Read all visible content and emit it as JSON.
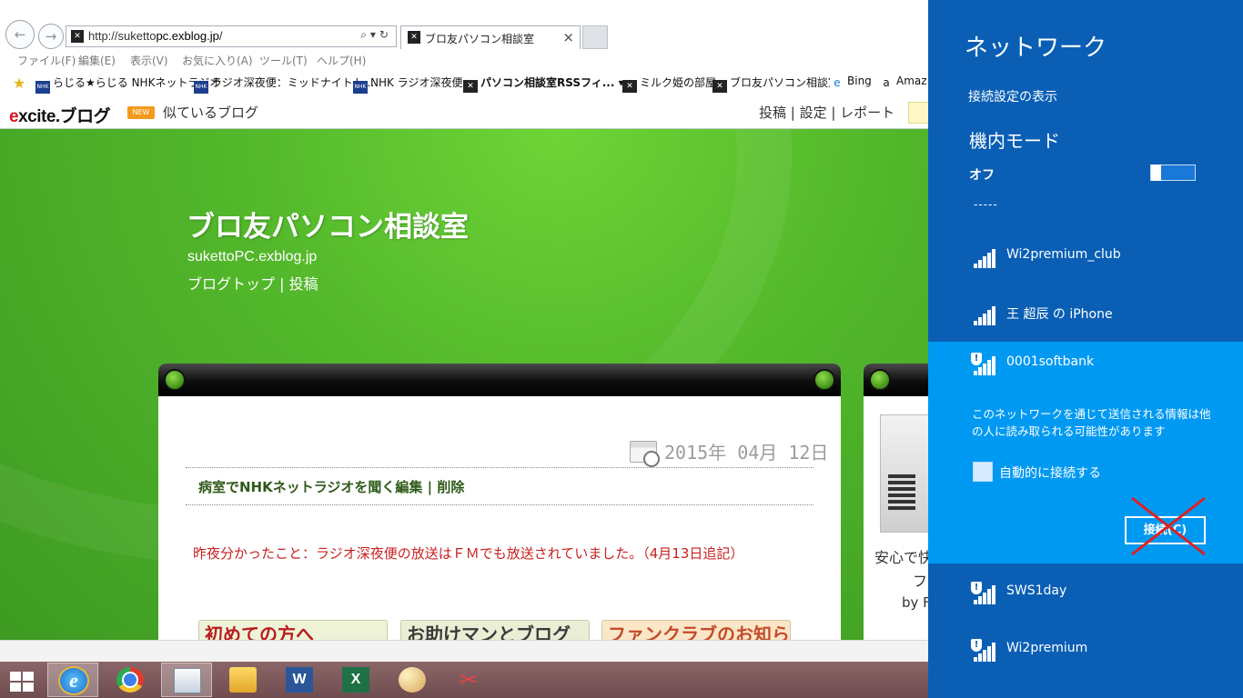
{
  "browser": {
    "url_prefix": "http://suketto",
    "url_domain": "pc.exblog.jp",
    "url_suffix": "/",
    "tab_title": "ブロ友パソコン相談室",
    "tab_close": "×",
    "menu": [
      "ファイル(F)",
      "編集(E)",
      "表示(V)",
      "お気に入り(A)",
      "ツール(T)",
      "ヘルプ(H)"
    ],
    "favorites": [
      {
        "icon": "NHK",
        "label": "らじる★らじる NHKネットラジオ"
      },
      {
        "icon": "NHK",
        "label": "ラジオ深夜便：ミッドナイトト..."
      },
      {
        "icon": "NHK",
        "label": "NHK ラジオ深夜便"
      },
      {
        "icon": "x",
        "label": "パソコン相談室RSSフィ... ▾"
      },
      {
        "icon": "x",
        "label": "ミルク姫の部屋"
      },
      {
        "icon": "x",
        "label": "ブロ友パソコン相談室"
      },
      {
        "icon": "e",
        "label": "Bing"
      },
      {
        "icon": "a",
        "label": "Amaz"
      }
    ]
  },
  "excite": {
    "logo_e": "e",
    "logo_rest": "xcite.ブログ",
    "new_badge": "NEW",
    "similar_link": "似ているブログ",
    "header_links": "投稿 | 設定 | レポート"
  },
  "blog": {
    "title": "ブロ友パソコン相談室",
    "domain": "sukettoPC.exblog.jp",
    "links": "ブログトップ | 投稿",
    "post_date": "2015年 04月 12日",
    "post_heading": "病室でNHKネットラジオを聞く編集 | 削除",
    "post_text": "昨夜分かったこと：ラジオ深夜便の放送はＦＭでも放送されていました。（4月13日追記）",
    "buttons": [
      "初めての方へ",
      "お助けマンとブログ",
      "ファンクラブのお知らせ"
    ],
    "side_text1": "安心で快",
    "side_text2": "フ",
    "side_text3": "by F"
  },
  "network": {
    "title": "ネットワーク",
    "settings_link": "接続設定の表示",
    "airplane_mode_label": "機内モード",
    "airplane_mode_state": "オフ",
    "dash": "-----",
    "networks": [
      {
        "name": "Wi2premium_club",
        "secured": false
      },
      {
        "name": "王 超辰 の iPhone",
        "secured": false
      },
      {
        "name": "0001softbank",
        "secured": true
      },
      {
        "name": "SWS1day",
        "secured": true
      },
      {
        "name": "Wi2premium",
        "secured": true
      }
    ],
    "selected_warning": "このネットワークを通じて送信される情報は他の人に読み取られる可能性があります",
    "auto_connect_label": "自動的に接続する",
    "connect_button": "接続(C)",
    "cross_color": "#e02020"
  },
  "taskbar": {
    "apps": [
      "start",
      "internet-explorer",
      "chrome",
      "remote-desktop",
      "file-explorer",
      "word",
      "excel",
      "paint",
      "snipping-tool"
    ],
    "word_letter": "W",
    "excel_letter": "X"
  },
  "colors": {
    "panel_bg": "#0a5fb5",
    "selected_bg": "#0099f2",
    "blog_green": "#53b82b",
    "post_red": "#c82020"
  }
}
